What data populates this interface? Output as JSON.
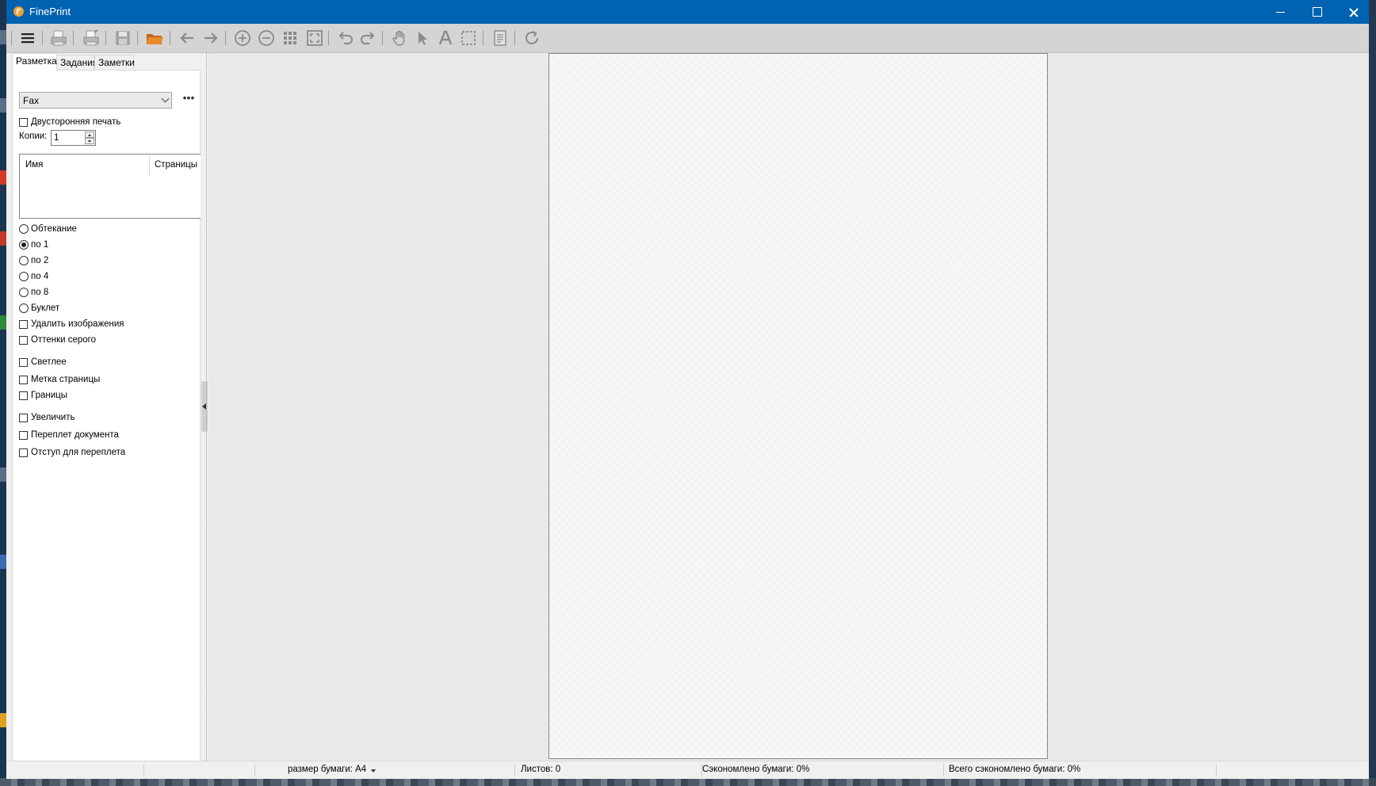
{
  "window": {
    "title": "FinePrint"
  },
  "toolbar": {
    "buttons": [
      "menu-icon",
      "print-icon",
      "print-settings-icon",
      "save-icon",
      "open-folder-icon",
      "back-arrow-icon",
      "forward-arrow-icon",
      "zoom-in-icon",
      "zoom-out-icon",
      "grid-view-icon",
      "fit-page-icon",
      "undo-icon",
      "redo-icon",
      "hand-tool-icon",
      "pointer-tool-icon",
      "text-tool-icon",
      "select-rect-icon",
      "page-settings-icon",
      "refresh-icon"
    ]
  },
  "tabs": [
    {
      "label": "Разметка",
      "active": true
    },
    {
      "label": "Задания",
      "active": false
    },
    {
      "label": "Заметки",
      "active": false
    }
  ],
  "printer": {
    "selected": "Fax",
    "more": "•••"
  },
  "duplex": {
    "label": "Двусторонняя печать",
    "checked": false
  },
  "copies": {
    "label": "Копии:",
    "value": "1"
  },
  "jobs": {
    "col_name": "Имя",
    "col_pages": "Страницы"
  },
  "layout_options": [
    {
      "label": "Обтекание",
      "checked": false
    },
    {
      "label": "по 1",
      "checked": true
    },
    {
      "label": "по 2",
      "checked": false
    },
    {
      "label": "по 4",
      "checked": false
    },
    {
      "label": "по 8",
      "checked": false
    },
    {
      "label": "Буклет",
      "checked": false
    }
  ],
  "checkboxes": [
    {
      "label": "Удалить изображения",
      "checked": false
    },
    {
      "label": "Оттенки серого",
      "checked": false
    },
    {
      "label": "Светлее",
      "checked": false
    },
    {
      "label": "Метка страницы",
      "checked": false
    },
    {
      "label": "Границы",
      "checked": false
    },
    {
      "label": "Увеличить",
      "checked": false
    },
    {
      "label": "Переплет документа",
      "checked": false
    },
    {
      "label": "Отступ для переплета",
      "checked": false
    }
  ],
  "status": {
    "paper_size": "размер бумаги: A4",
    "sheets": "Листов: 0",
    "saved": "Сэкономлено бумаги: 0%",
    "total_saved": "Всего сэкономлено бумаги: 0%"
  },
  "colors": {
    "titlebar": "#0063b1",
    "accent_folder": "#e27b1e"
  }
}
